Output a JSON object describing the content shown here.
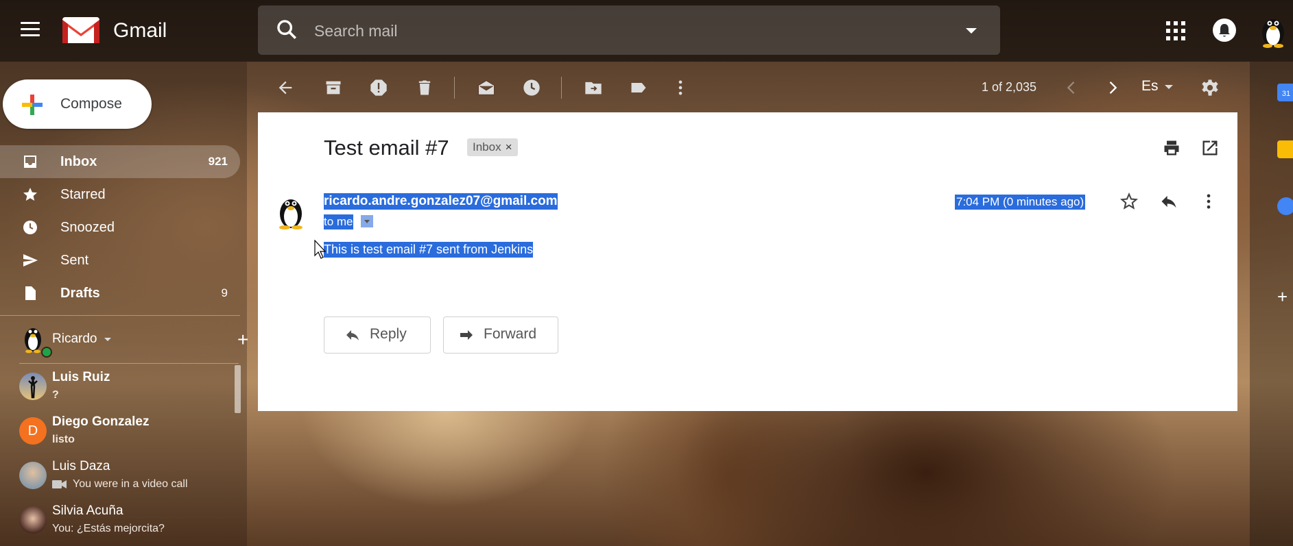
{
  "app": {
    "brand": "Gmail"
  },
  "search": {
    "placeholder": "Search mail"
  },
  "compose": {
    "label": "Compose"
  },
  "nav": [
    {
      "label": "Inbox",
      "count": "921",
      "icon": "inbox-icon",
      "active": true
    },
    {
      "label": "Starred",
      "count": "",
      "icon": "star-icon"
    },
    {
      "label": "Snoozed",
      "count": "",
      "icon": "clock-icon"
    },
    {
      "label": "Sent",
      "count": "",
      "icon": "send-icon"
    },
    {
      "label": "Drafts",
      "count": "9",
      "icon": "draft-icon"
    }
  ],
  "hangouts": {
    "me": "Ricardo",
    "contacts": [
      {
        "name": "Luis Ruiz",
        "message": "?"
      },
      {
        "name": "Diego Gonzalez",
        "message": "listo",
        "initial": "D"
      },
      {
        "name": "Luis Daza",
        "message": "You were in a video call"
      },
      {
        "name": "Silvia Acuña",
        "message": "You: ¿Estás mejorcita?"
      }
    ]
  },
  "toolbar": {
    "pager": "1 of 2,035",
    "language": "Es",
    "icons": [
      "back-arrow-icon",
      "archive-icon",
      "report-spam-icon",
      "delete-icon",
      "mark-unread-icon",
      "snooze-icon",
      "move-to-icon",
      "label-icon",
      "more-vert-icon"
    ]
  },
  "message": {
    "subject": "Test email #7",
    "label": "Inbox",
    "label_remove": "×",
    "sender": "ricardo.andre.gonzalez07@gmail.com",
    "recipient": "to me",
    "time": "7:04 PM (0 minutes ago)",
    "body": "This is test email #7 sent from Jenkins",
    "reply_label": "Reply",
    "forward_label": "Forward"
  },
  "rail": {
    "calendar_day": "31"
  },
  "colors": {
    "selection": "#2a6cdc",
    "gmail_red": "#ea4335",
    "diego_avatar": "#f4711f",
    "online": "#1ea446"
  }
}
